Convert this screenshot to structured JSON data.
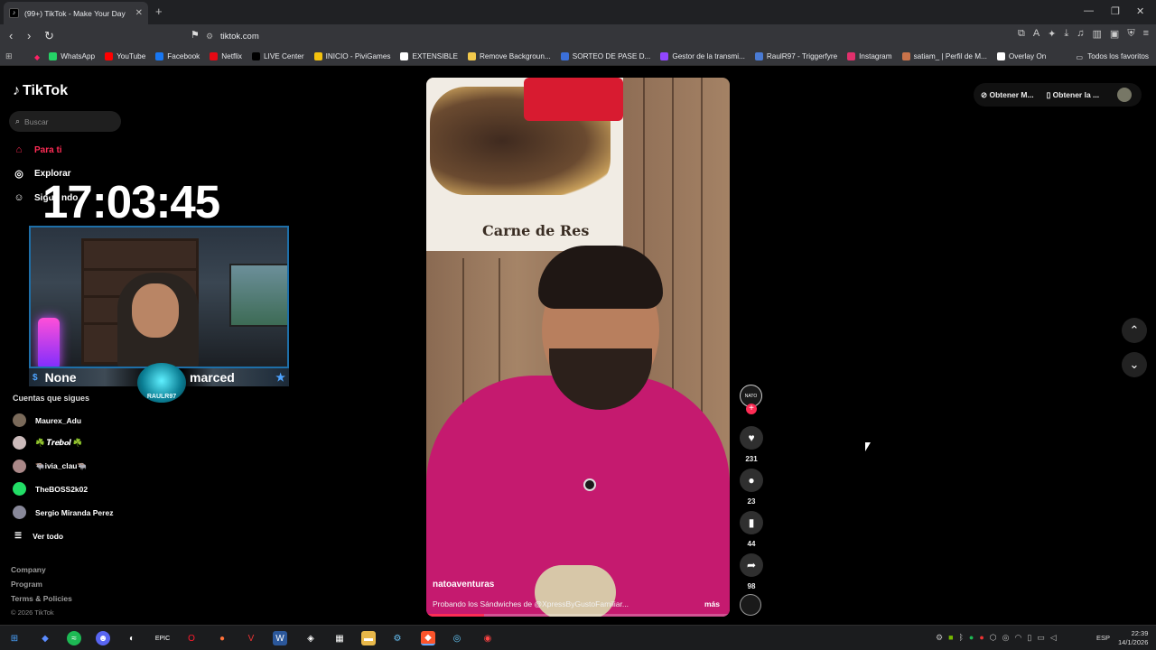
{
  "browser": {
    "tab_title": "(99+) TikTok - Make Your Day",
    "url": "tiktok.com",
    "bookmarks": [
      {
        "label": "WhatsApp",
        "color": "#25d366"
      },
      {
        "label": "YouTube",
        "color": "#ff0000"
      },
      {
        "label": "Facebook",
        "color": "#1877f2"
      },
      {
        "label": "Netflix",
        "color": "#e50914"
      },
      {
        "label": "LIVE Center",
        "color": "#000000"
      },
      {
        "label": "INICIO - PiviGames",
        "color": "#f4c20d"
      },
      {
        "label": "EXTENSIBLE",
        "color": "#ffffff"
      },
      {
        "label": "Remove Backgroun...",
        "color": "#f2c94c"
      },
      {
        "label": "SORTEO DE PASE D...",
        "color": "#3b6fd8"
      },
      {
        "label": "Gestor de la transmi...",
        "color": "#9146ff"
      },
      {
        "label": "RaulR97 - Triggerfyre",
        "color": "#4a7bd4"
      },
      {
        "label": "Instagram",
        "color": "#e1306c"
      },
      {
        "label": "satiam_ | Perfil de M...",
        "color": "#c9734a"
      },
      {
        "label": "Overlay On",
        "color": "#ffffff"
      }
    ],
    "all_favorites": "Todos los favoritos"
  },
  "sidebar": {
    "logo": "TikTok",
    "search_placeholder": "Buscar",
    "nav": [
      {
        "label": "Para ti",
        "icon": "home-icon"
      },
      {
        "label": "Explorar",
        "icon": "compass-icon"
      },
      {
        "label": "Siguiendo",
        "icon": "following-icon"
      }
    ],
    "following_title": "Cuentas que sigues",
    "following": [
      {
        "name": "Maurex_Adu"
      },
      {
        "name": "☘️ 𝑻𝒓𝒆𝒃𝒐𝒍 ☘️"
      },
      {
        "name": "🐃ivia_clau🐃"
      },
      {
        "name": "TheBOSS2k02"
      },
      {
        "name": "Sergio Miranda Perez"
      }
    ],
    "see_all": "Ver todo",
    "footer": [
      "Company",
      "Program",
      "Terms & Policies"
    ],
    "copyright": "© 2026 TikTok"
  },
  "overlay": {
    "clock": "17:03:45",
    "label_left": "None",
    "label_right": "marced",
    "badge": "RAULR97"
  },
  "video": {
    "poster_text": "Carne de Res",
    "author": "natoaventuras",
    "description": "Probando los Sándwiches de @XpressByGustoFamiliar...",
    "more": "más",
    "progress_fraction": 0.19,
    "likes": "231",
    "comments": "23",
    "saves": "44",
    "shares": "98"
  },
  "topbar": {
    "get_coins": "Obtener M...",
    "get_app": "Obtener la ..."
  },
  "taskbar": {
    "language": "ESP",
    "time": "22:39",
    "date": "14/1/2026"
  }
}
